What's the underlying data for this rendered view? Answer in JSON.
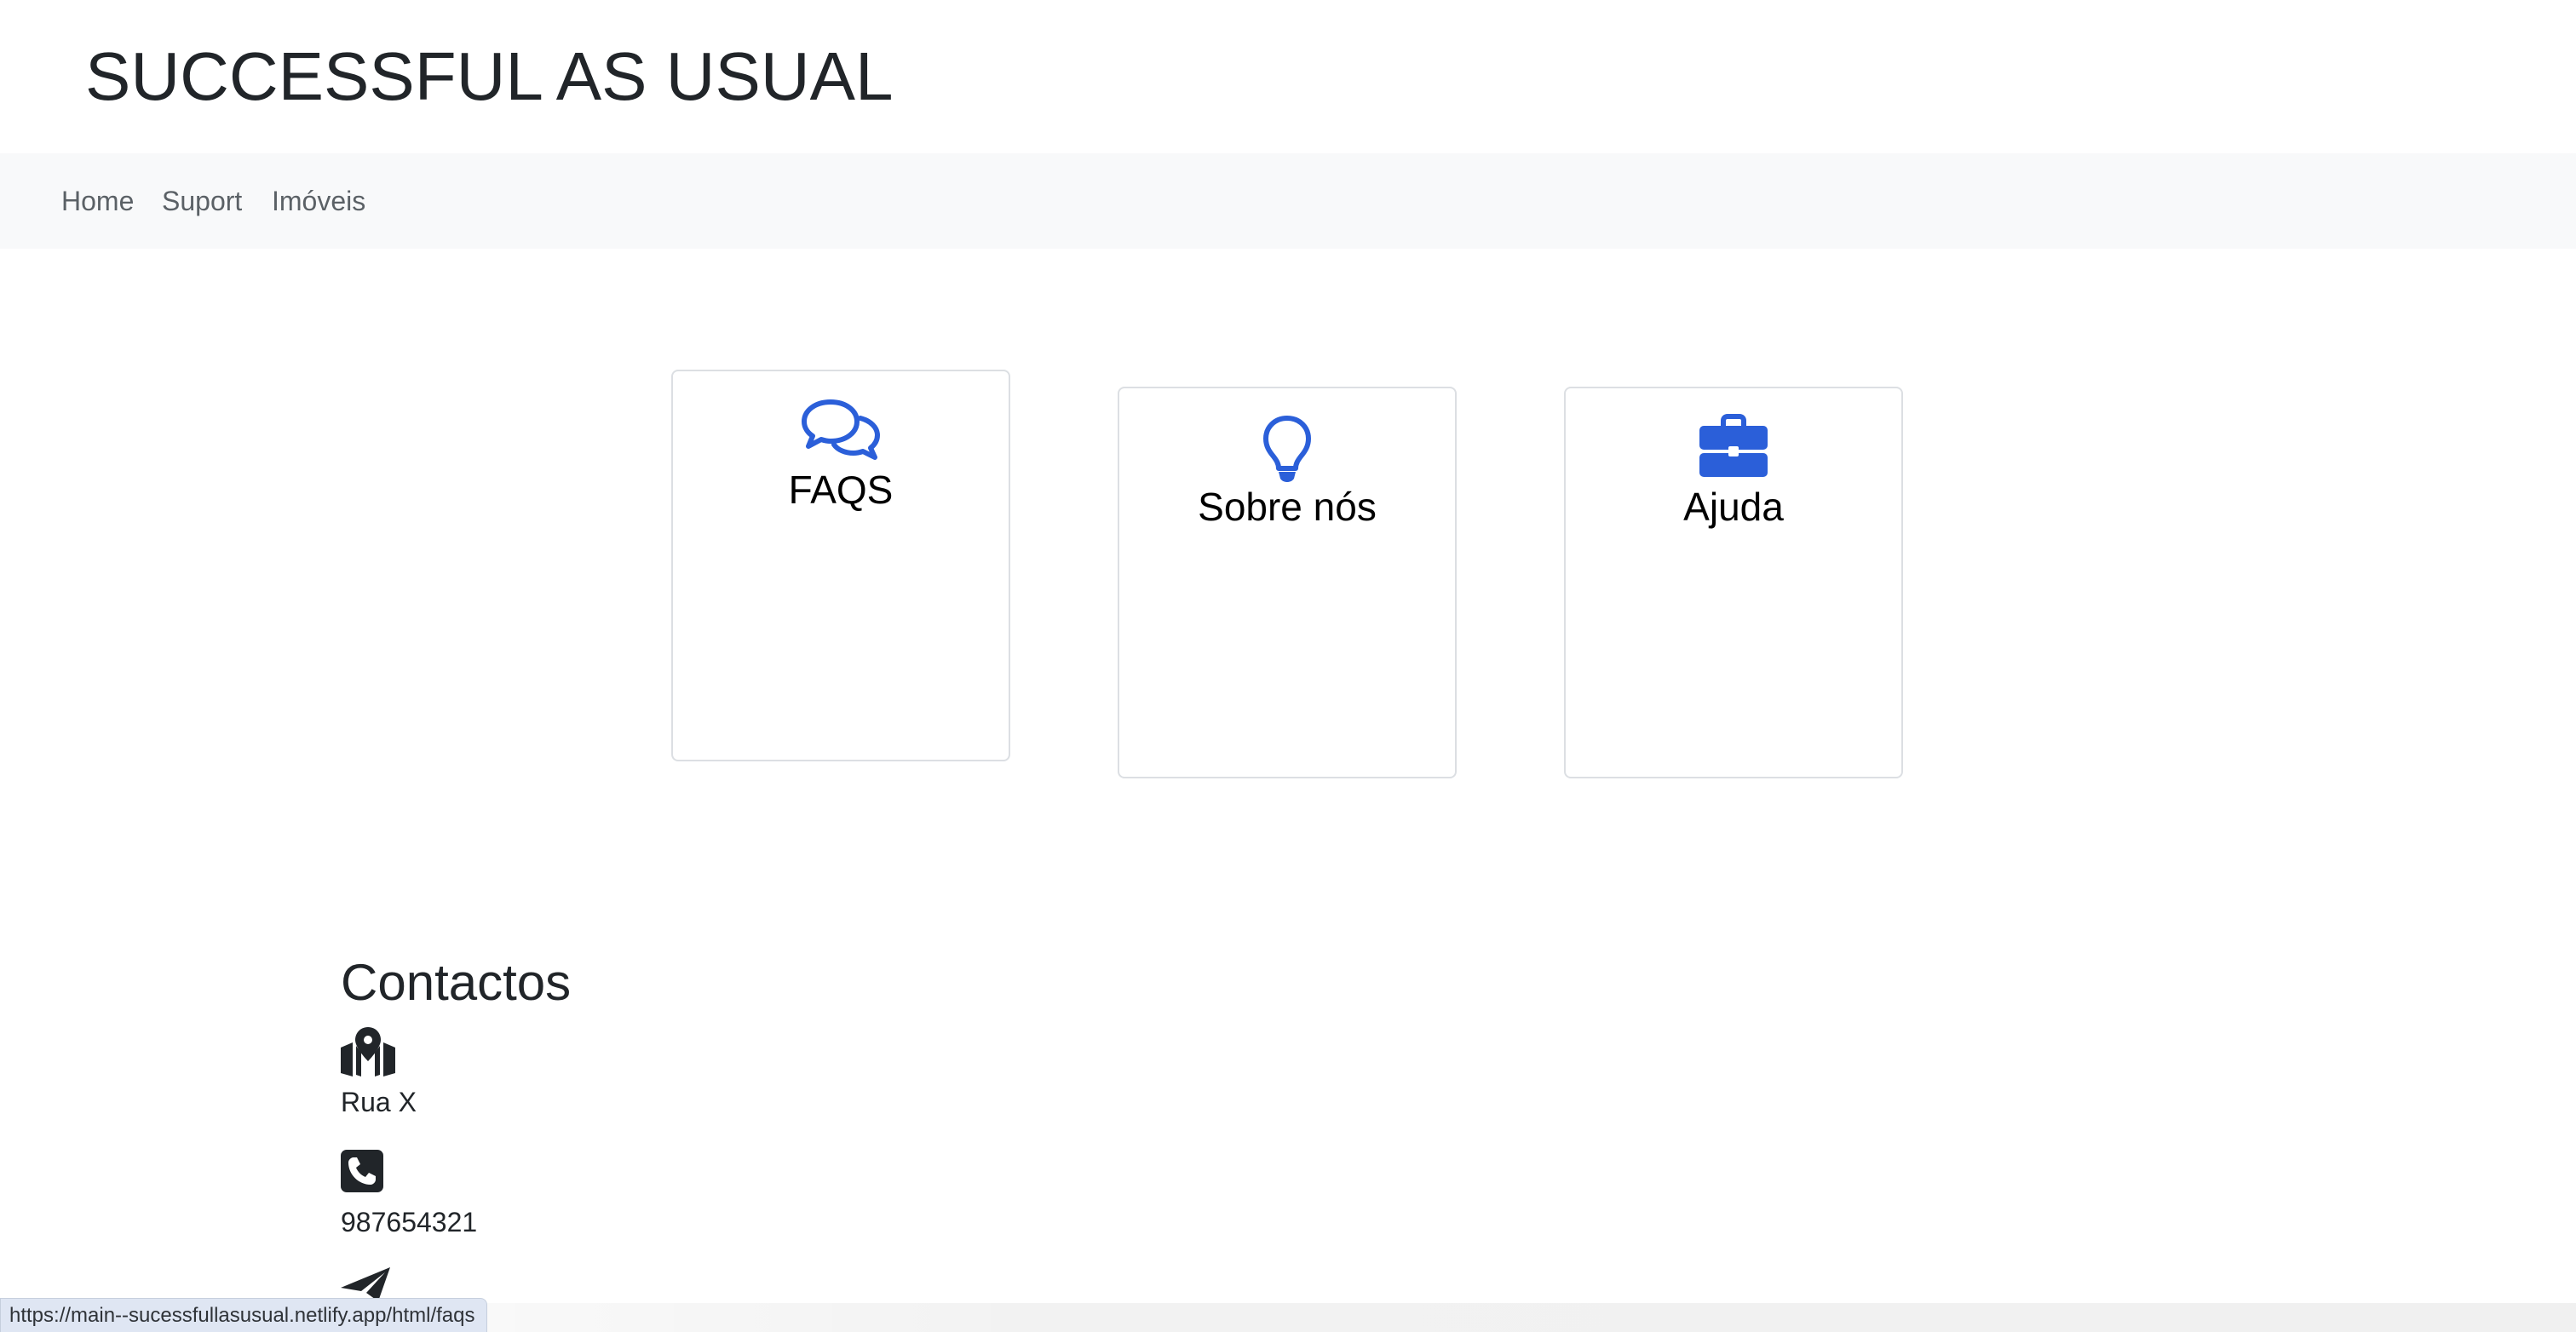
{
  "header": {
    "title": "SUCCESSFUL AS USUAL"
  },
  "nav": {
    "items": [
      {
        "label": "Home"
      },
      {
        "label": "Suport"
      },
      {
        "label": "Imóveis"
      }
    ]
  },
  "cards": [
    {
      "title": "FAQS",
      "icon": "chat-bubbles-icon"
    },
    {
      "title": "Sobre nós",
      "icon": "lightbulb-icon"
    },
    {
      "title": "Ajuda",
      "icon": "briefcase-icon"
    }
  ],
  "contacts": {
    "heading": "Contactos",
    "items": [
      {
        "icon": "map-location-icon",
        "text": "Rua X"
      },
      {
        "icon": "phone-icon",
        "text": "987654321"
      },
      {
        "icon": "paper-plane-icon",
        "text": ""
      }
    ]
  },
  "status_bar": {
    "url": "https://main--sucessfullasusual.netlify.app/html/faqs"
  },
  "colors": {
    "accent_blue": "#2b5fd9",
    "icon_dark": "#212529",
    "navbar_bg": "#f8f9fa"
  }
}
